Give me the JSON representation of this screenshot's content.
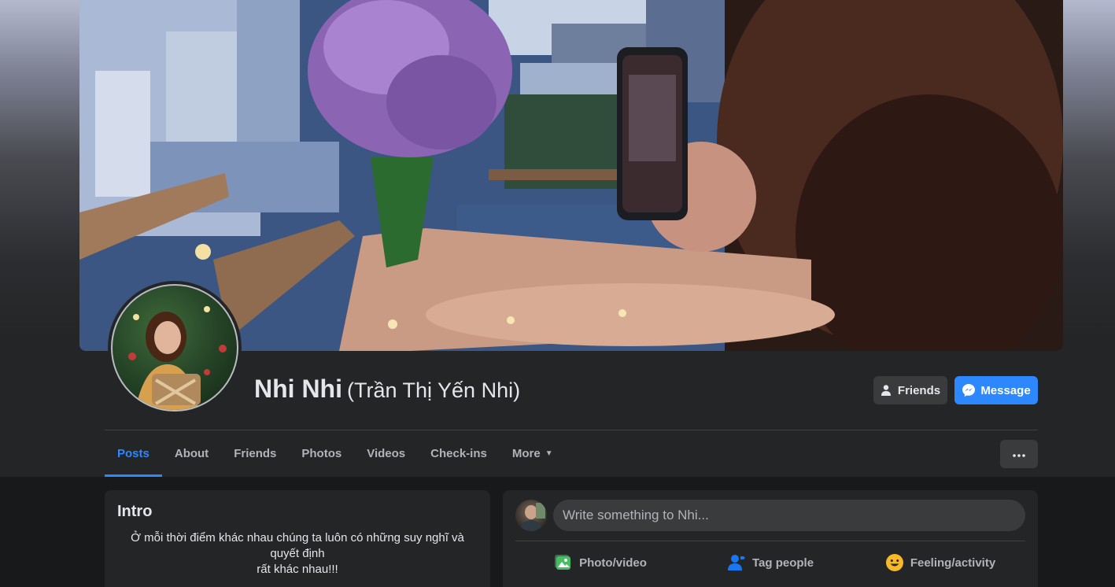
{
  "profile": {
    "name": "Nhi Nhi",
    "alternate_name": "(Trần Thị Yến Nhi)"
  },
  "actions": {
    "friends_label": "Friends",
    "message_label": "Message"
  },
  "tabs": [
    {
      "label": "Posts",
      "active": true
    },
    {
      "label": "About"
    },
    {
      "label": "Friends"
    },
    {
      "label": "Photos"
    },
    {
      "label": "Videos"
    },
    {
      "label": "Check-ins"
    },
    {
      "label": "More"
    }
  ],
  "intro": {
    "title": "Intro",
    "bio_line1": "Ở mỗi thời điểm khác nhau chúng ta luôn có những suy nghĩ và quyết định",
    "bio_line2": "rất khác nhau!!!"
  },
  "composer": {
    "placeholder": "Write something to Nhi...",
    "photo_video_label": "Photo/video",
    "tag_people_label": "Tag people",
    "feeling_label": "Feeling/activity"
  },
  "colors": {
    "accent": "#2d88ff",
    "photo_icon": "#45bd62",
    "tag_icon": "#1877f2",
    "feeling_icon": "#f7b928"
  },
  "icons": {
    "friends": "person-check-icon",
    "message": "messenger-icon",
    "more": "ellipsis-icon",
    "photo": "photo-icon",
    "tag": "tag-people-icon",
    "feeling": "smiley-icon"
  }
}
